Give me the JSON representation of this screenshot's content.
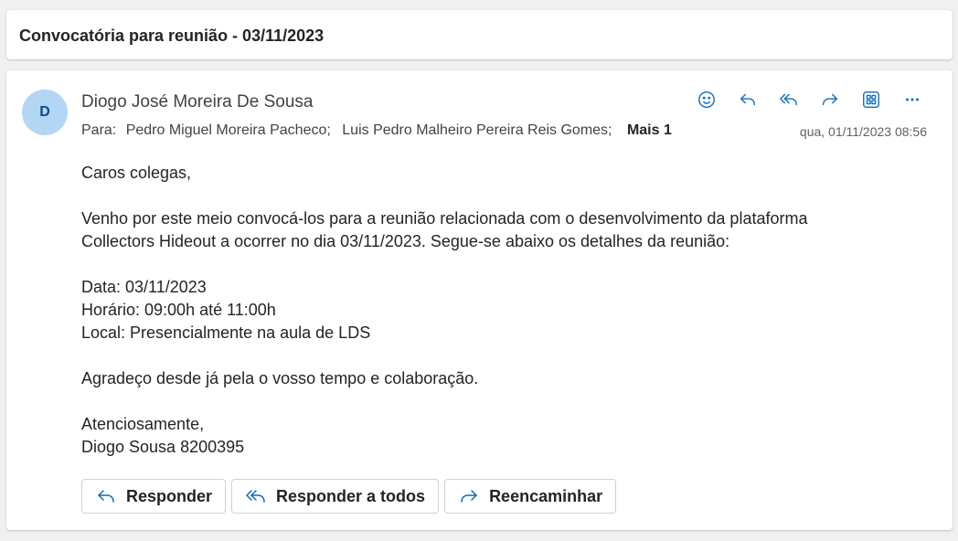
{
  "subject": "Convocatória para reunião - 03/11/2023",
  "message": {
    "avatar_initial": "D",
    "sender": "Diogo José Moreira De Sousa",
    "to_label": "Para:",
    "recipients": [
      "Pedro Miguel Moreira Pacheco;",
      "Luis Pedro Malheiro Pereira Reis Gomes;"
    ],
    "more_label": "Mais 1",
    "timestamp": "qua, 01/11/2023 08:56",
    "actions": [
      {
        "name": "emoji-react",
        "icon": "smiley-icon"
      },
      {
        "name": "reply",
        "icon": "reply-icon"
      },
      {
        "name": "reply-all",
        "icon": "reply-all-icon"
      },
      {
        "name": "forward",
        "icon": "forward-icon"
      },
      {
        "name": "apps",
        "icon": "apps-icon"
      },
      {
        "name": "more",
        "icon": "more-icon"
      }
    ],
    "body": {
      "greeting": "Caros colegas,",
      "paragraph1_line1": "Venho por este meio convocá-los para a reunião relacionada com o desenvolvimento da plataforma",
      "paragraph1_line2": "Collectors Hideout a ocorrer no dia 03/11/2023. Segue-se abaixo os detalhes da reunião:",
      "date_line": "Data: 03/11/2023",
      "time_line": "Horário: 09:00h até 11:00h",
      "place_line": "Local: Presencialmente na aula de LDS",
      "thanks": "Agradeço desde já pela o vosso tempo e colaboração.",
      "closing": "Atenciosamente,",
      "signature": "Diogo Sousa 8200395"
    },
    "buttons": {
      "reply": "Responder",
      "reply_all": "Responder a todos",
      "forward": "Reencaminhar"
    }
  },
  "colors": {
    "accent": "#0f6cbd",
    "avatar_bg": "#b3d6f5",
    "avatar_text": "#0f4a85"
  }
}
